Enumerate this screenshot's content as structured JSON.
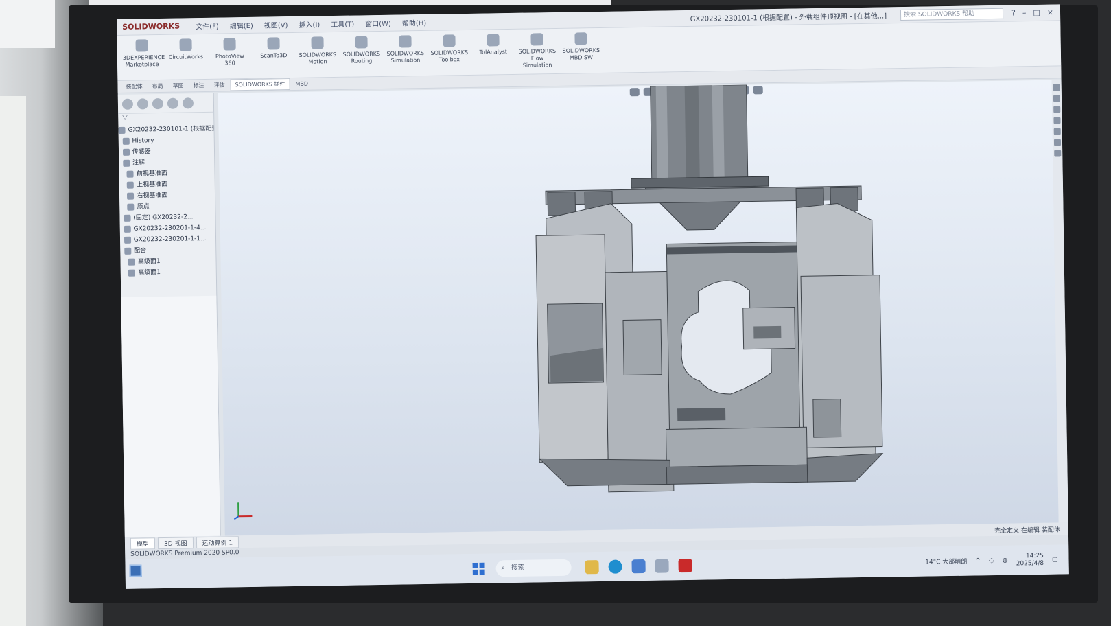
{
  "app": {
    "logo": "SOLIDWORKS",
    "window_title": "GX20232-230101-1 (根据配置) - 外载组件顶视图 - [在其他...]",
    "menus": [
      "文件(F)",
      "编辑(E)",
      "视图(V)",
      "插入(I)",
      "工具(T)",
      "窗口(W)",
      "帮助(H)"
    ],
    "search_placeholder": "搜索 SOLIDWORKS 帮助"
  },
  "ribbon": {
    "tools": [
      "3DEXPERIENCE Marketplace",
      "CircuitWorks",
      "PhotoView 360",
      "ScanTo3D",
      "SOLIDWORKS Motion",
      "SOLIDWORKS Routing",
      "SOLIDWORKS Simulation",
      "SOLIDWORKS Toolbox",
      "TolAnalyst",
      "SOLIDWORKS Flow Simulation",
      "SOLIDWORKS MBD SW"
    ]
  },
  "command_tabs": [
    "装配体",
    "布局",
    "草图",
    "标注",
    "评估",
    "SOLIDWORKS 插件",
    "MBD"
  ],
  "tree": {
    "root": "GX20232-230101-1 (根据配置)",
    "items": [
      {
        "label": "History"
      },
      {
        "label": "传感器"
      },
      {
        "label": "注解"
      },
      {
        "label": "前视基准面"
      },
      {
        "label": "上视基准面"
      },
      {
        "label": "右视基准面"
      },
      {
        "label": "原点"
      },
      {
        "label": "(固定) GX20232-2..."
      },
      {
        "label": "GX20232-230201-1-4..."
      },
      {
        "label": "GX20232-230201-1-1..."
      },
      {
        "label": "配合"
      },
      {
        "label": "高级面1"
      },
      {
        "label": "高级面1"
      }
    ]
  },
  "bottom_tabs": [
    "模型",
    "3D 视图",
    "运动算例 1"
  ],
  "status": {
    "product": "SOLIDWORKS Premium 2020 SP0.0",
    "right": "完全定义  在编辑 装配体"
  },
  "taskbar": {
    "search_label": "搜索",
    "tray_temp": "14°C 大部晴朗",
    "time": "14:25",
    "date": "2025/4/8"
  },
  "colors": {
    "accent": "#2f6fd0",
    "viewport_top": "#eef3fa",
    "model_gray": "#8f959c"
  }
}
